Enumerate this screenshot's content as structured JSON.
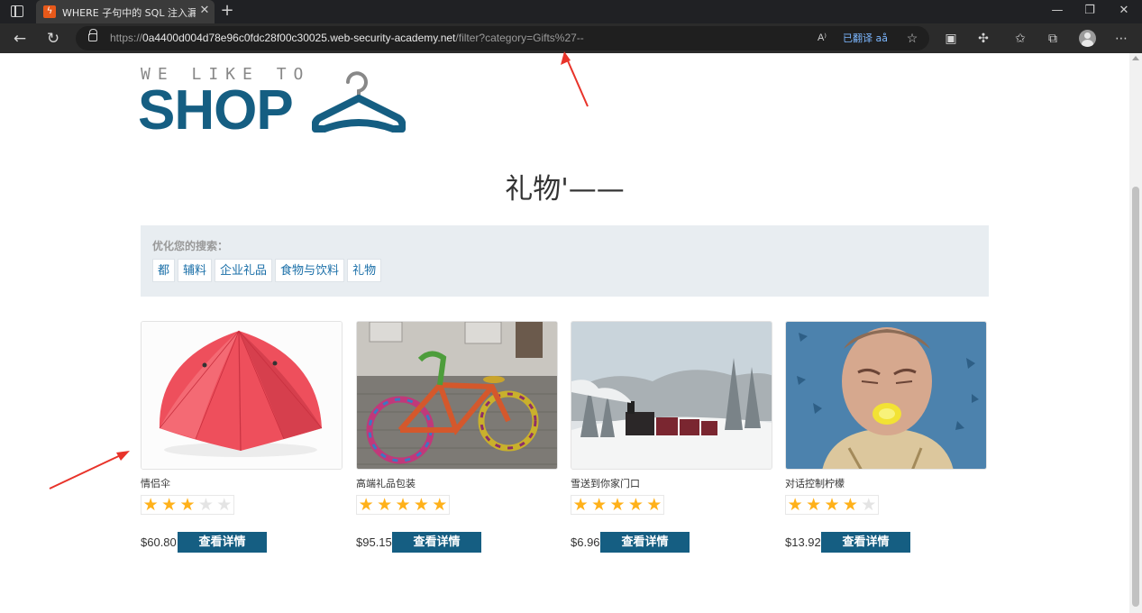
{
  "browser": {
    "tab_title": "WHERE 子句中的 SQL 注入漏洞允",
    "url_proto": "https://",
    "url_host": "0a4400d004d78e96c0fdc28f00c30025.web-security-academy.net",
    "url_path": "/filter?category=Gifts%27--",
    "read_aloud_label": "A⁾",
    "translated_label": "已翻译",
    "translate_icon_label": "aå"
  },
  "page": {
    "logo_tagline": "WE LIKE TO",
    "logo_word": "SHOP",
    "title": "礼物'——",
    "filter_label": "优化您的搜索：",
    "filters": [
      "都",
      "辅料",
      "企业礼品",
      "食物与饮料",
      "礼物"
    ]
  },
  "products": [
    {
      "name": "情侣伞",
      "rating": 3,
      "price": "$60.80",
      "button": "查看详情",
      "image": "red-umbrella"
    },
    {
      "name": "高端礼品包装",
      "rating": 5,
      "price": "$95.15",
      "button": "查看详情",
      "image": "knitted-bicycle"
    },
    {
      "name": "雪送到你家门口",
      "rating": 5,
      "price": "$6.96",
      "button": "查看详情",
      "image": "snow-train"
    },
    {
      "name": "对话控制柠檬",
      "rating": 4,
      "price": "$13.92",
      "button": "查看详情",
      "image": "lemon-man"
    }
  ],
  "colors": {
    "brand": "#155e82",
    "star": "#ffb11a",
    "link": "#1a6fa8",
    "annotation": "#e8332a"
  }
}
